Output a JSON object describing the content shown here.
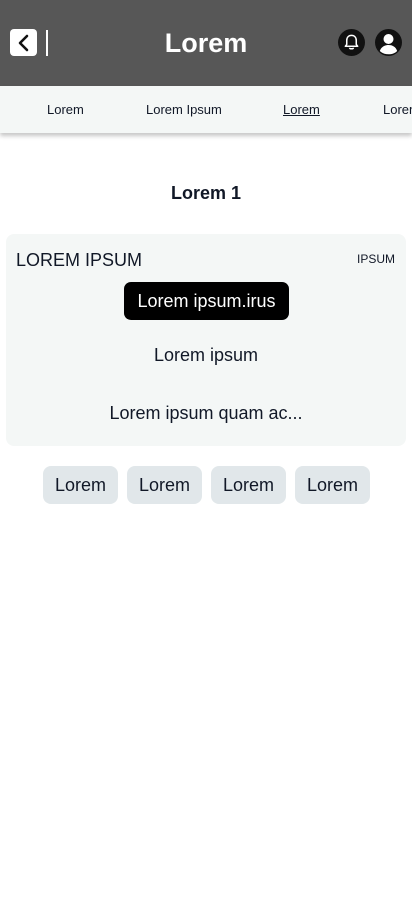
{
  "header": {
    "title": "Lorem",
    "back_icon": "chevron-left-icon",
    "notifications_icon": "bell-icon",
    "profile_icon": "user-icon"
  },
  "tabs": [
    {
      "label": "Lorem",
      "active": false
    },
    {
      "label": "Lorem Ipsum",
      "active": false
    },
    {
      "label": "Lorem",
      "active": true
    },
    {
      "label": "Lorem",
      "active": false
    }
  ],
  "section": {
    "title": "Lorem 1"
  },
  "card": {
    "title": "LOREM IPSUM",
    "tag": "IPSUM",
    "pill": "Lorem ipsum.irus",
    "line1": "Lorem ipsum",
    "line2": "Lorem ipsum quam ac..."
  },
  "chips": [
    "Lorem",
    "Lorem",
    "Lorem",
    "Lorem"
  ],
  "colors": {
    "header_bg": "#575757",
    "tab_bar_bg": "#f4f7f6",
    "card_bg": "#f4f7f6",
    "pill_bg": "#000000",
    "chip_bg": "#e1e7ea"
  }
}
